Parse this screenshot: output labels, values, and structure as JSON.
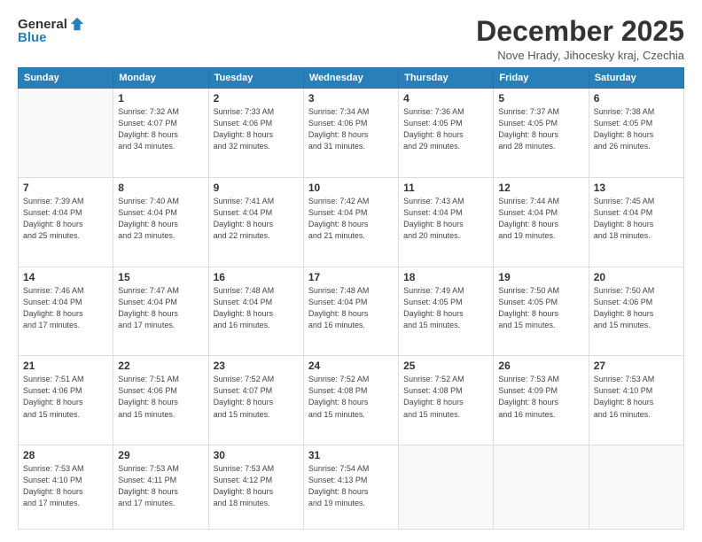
{
  "logo": {
    "general": "General",
    "blue": "Blue"
  },
  "title": "December 2025",
  "location": "Nove Hrady, Jihocesky kraj, Czechia",
  "days_header": [
    "Sunday",
    "Monday",
    "Tuesday",
    "Wednesday",
    "Thursday",
    "Friday",
    "Saturday"
  ],
  "weeks": [
    [
      {
        "day": "",
        "info": ""
      },
      {
        "day": "1",
        "info": "Sunrise: 7:32 AM\nSunset: 4:07 PM\nDaylight: 8 hours\nand 34 minutes."
      },
      {
        "day": "2",
        "info": "Sunrise: 7:33 AM\nSunset: 4:06 PM\nDaylight: 8 hours\nand 32 minutes."
      },
      {
        "day": "3",
        "info": "Sunrise: 7:34 AM\nSunset: 4:06 PM\nDaylight: 8 hours\nand 31 minutes."
      },
      {
        "day": "4",
        "info": "Sunrise: 7:36 AM\nSunset: 4:05 PM\nDaylight: 8 hours\nand 29 minutes."
      },
      {
        "day": "5",
        "info": "Sunrise: 7:37 AM\nSunset: 4:05 PM\nDaylight: 8 hours\nand 28 minutes."
      },
      {
        "day": "6",
        "info": "Sunrise: 7:38 AM\nSunset: 4:05 PM\nDaylight: 8 hours\nand 26 minutes."
      }
    ],
    [
      {
        "day": "7",
        "info": "Sunrise: 7:39 AM\nSunset: 4:04 PM\nDaylight: 8 hours\nand 25 minutes."
      },
      {
        "day": "8",
        "info": "Sunrise: 7:40 AM\nSunset: 4:04 PM\nDaylight: 8 hours\nand 23 minutes."
      },
      {
        "day": "9",
        "info": "Sunrise: 7:41 AM\nSunset: 4:04 PM\nDaylight: 8 hours\nand 22 minutes."
      },
      {
        "day": "10",
        "info": "Sunrise: 7:42 AM\nSunset: 4:04 PM\nDaylight: 8 hours\nand 21 minutes."
      },
      {
        "day": "11",
        "info": "Sunrise: 7:43 AM\nSunset: 4:04 PM\nDaylight: 8 hours\nand 20 minutes."
      },
      {
        "day": "12",
        "info": "Sunrise: 7:44 AM\nSunset: 4:04 PM\nDaylight: 8 hours\nand 19 minutes."
      },
      {
        "day": "13",
        "info": "Sunrise: 7:45 AM\nSunset: 4:04 PM\nDaylight: 8 hours\nand 18 minutes."
      }
    ],
    [
      {
        "day": "14",
        "info": "Sunrise: 7:46 AM\nSunset: 4:04 PM\nDaylight: 8 hours\nand 17 minutes."
      },
      {
        "day": "15",
        "info": "Sunrise: 7:47 AM\nSunset: 4:04 PM\nDaylight: 8 hours\nand 17 minutes."
      },
      {
        "day": "16",
        "info": "Sunrise: 7:48 AM\nSunset: 4:04 PM\nDaylight: 8 hours\nand 16 minutes."
      },
      {
        "day": "17",
        "info": "Sunrise: 7:48 AM\nSunset: 4:04 PM\nDaylight: 8 hours\nand 16 minutes."
      },
      {
        "day": "18",
        "info": "Sunrise: 7:49 AM\nSunset: 4:05 PM\nDaylight: 8 hours\nand 15 minutes."
      },
      {
        "day": "19",
        "info": "Sunrise: 7:50 AM\nSunset: 4:05 PM\nDaylight: 8 hours\nand 15 minutes."
      },
      {
        "day": "20",
        "info": "Sunrise: 7:50 AM\nSunset: 4:06 PM\nDaylight: 8 hours\nand 15 minutes."
      }
    ],
    [
      {
        "day": "21",
        "info": "Sunrise: 7:51 AM\nSunset: 4:06 PM\nDaylight: 8 hours\nand 15 minutes."
      },
      {
        "day": "22",
        "info": "Sunrise: 7:51 AM\nSunset: 4:06 PM\nDaylight: 8 hours\nand 15 minutes."
      },
      {
        "day": "23",
        "info": "Sunrise: 7:52 AM\nSunset: 4:07 PM\nDaylight: 8 hours\nand 15 minutes."
      },
      {
        "day": "24",
        "info": "Sunrise: 7:52 AM\nSunset: 4:08 PM\nDaylight: 8 hours\nand 15 minutes."
      },
      {
        "day": "25",
        "info": "Sunrise: 7:52 AM\nSunset: 4:08 PM\nDaylight: 8 hours\nand 15 minutes."
      },
      {
        "day": "26",
        "info": "Sunrise: 7:53 AM\nSunset: 4:09 PM\nDaylight: 8 hours\nand 16 minutes."
      },
      {
        "day": "27",
        "info": "Sunrise: 7:53 AM\nSunset: 4:10 PM\nDaylight: 8 hours\nand 16 minutes."
      }
    ],
    [
      {
        "day": "28",
        "info": "Sunrise: 7:53 AM\nSunset: 4:10 PM\nDaylight: 8 hours\nand 17 minutes."
      },
      {
        "day": "29",
        "info": "Sunrise: 7:53 AM\nSunset: 4:11 PM\nDaylight: 8 hours\nand 17 minutes."
      },
      {
        "day": "30",
        "info": "Sunrise: 7:53 AM\nSunset: 4:12 PM\nDaylight: 8 hours\nand 18 minutes."
      },
      {
        "day": "31",
        "info": "Sunrise: 7:54 AM\nSunset: 4:13 PM\nDaylight: 8 hours\nand 19 minutes."
      },
      {
        "day": "",
        "info": ""
      },
      {
        "day": "",
        "info": ""
      },
      {
        "day": "",
        "info": ""
      }
    ]
  ]
}
